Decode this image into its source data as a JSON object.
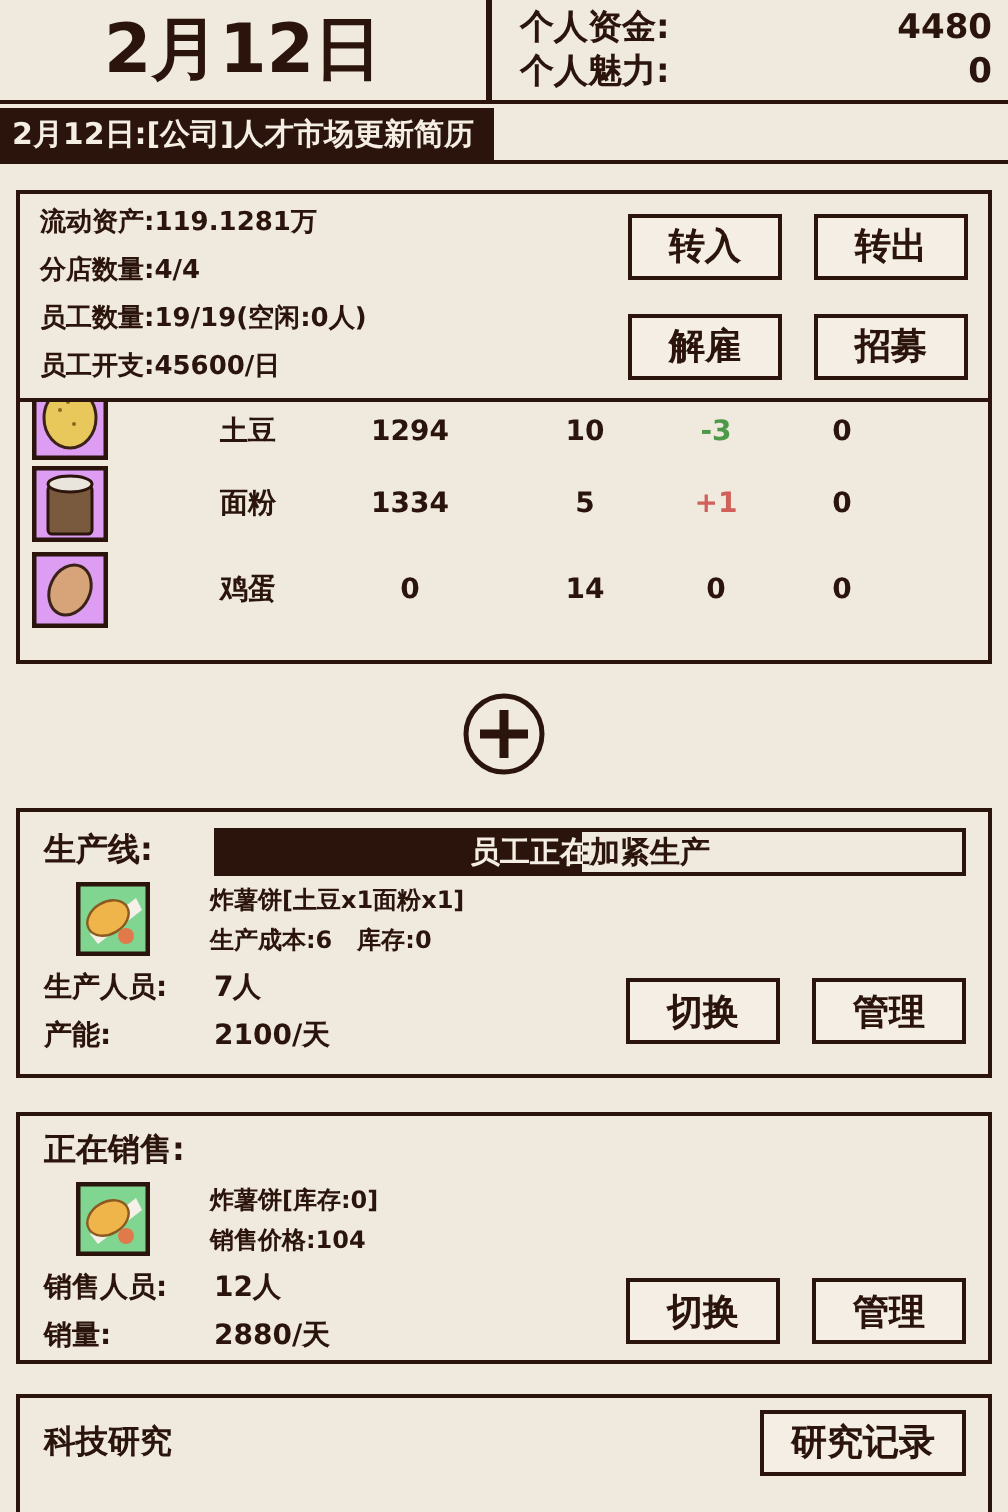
{
  "header": {
    "date": "2月12日",
    "stats": [
      {
        "label": "个人资金:",
        "value": "4480"
      },
      {
        "label": "个人魅力:",
        "value": "0"
      }
    ]
  },
  "news": {
    "text": "2月12日:[公司]人才市场更新简历",
    "level": 0.49
  },
  "company": {
    "lines": [
      "流动资产:119.1281万",
      "分店数量:4/4",
      "员工数量:19/19(空闲:0人)",
      "员工开支:45600/日"
    ],
    "buttons": [
      "转入",
      "转出",
      "解雇",
      "招募"
    ]
  },
  "inventory": [
    {
      "kind": "potato",
      "name": "土豆",
      "stock": "1294",
      "price": "10",
      "change": "-3",
      "color": "#4c9a48",
      "column_5": "0"
    },
    {
      "kind": "flour",
      "name": "面粉",
      "stock": "1334",
      "price": "5",
      "change": "+1",
      "color": "#d0605a",
      "column_5": "0"
    },
    {
      "kind": "egg",
      "name": "鸡蛋",
      "stock": "0",
      "price": "14",
      "change": "0",
      "color": "#2a140c",
      "column_5": "0"
    }
  ],
  "production": {
    "title": "生产线:",
    "status": "员工正在加紧生产",
    "level": 0.49,
    "product": "炸薯饼[土豆x1面粉x1]",
    "detail": "生产成本:6   库存:0",
    "rows": [
      {
        "label": "生产人员:",
        "value": "7人"
      },
      {
        "label": "产能:",
        "value": "2100/天"
      }
    ],
    "buttons": [
      "切换",
      "管理"
    ]
  },
  "sales": {
    "title": "正在销售:",
    "product": "炸薯饼[库存:0]",
    "detail": "销售价格:104",
    "rows": [
      {
        "label": "销售人员:",
        "value": "12人"
      },
      {
        "label": "销量:",
        "value": "2880/天"
      }
    ],
    "buttons": [
      "切换",
      "管理"
    ]
  },
  "research": {
    "title": "科技研究",
    "button": "研究记录"
  }
}
